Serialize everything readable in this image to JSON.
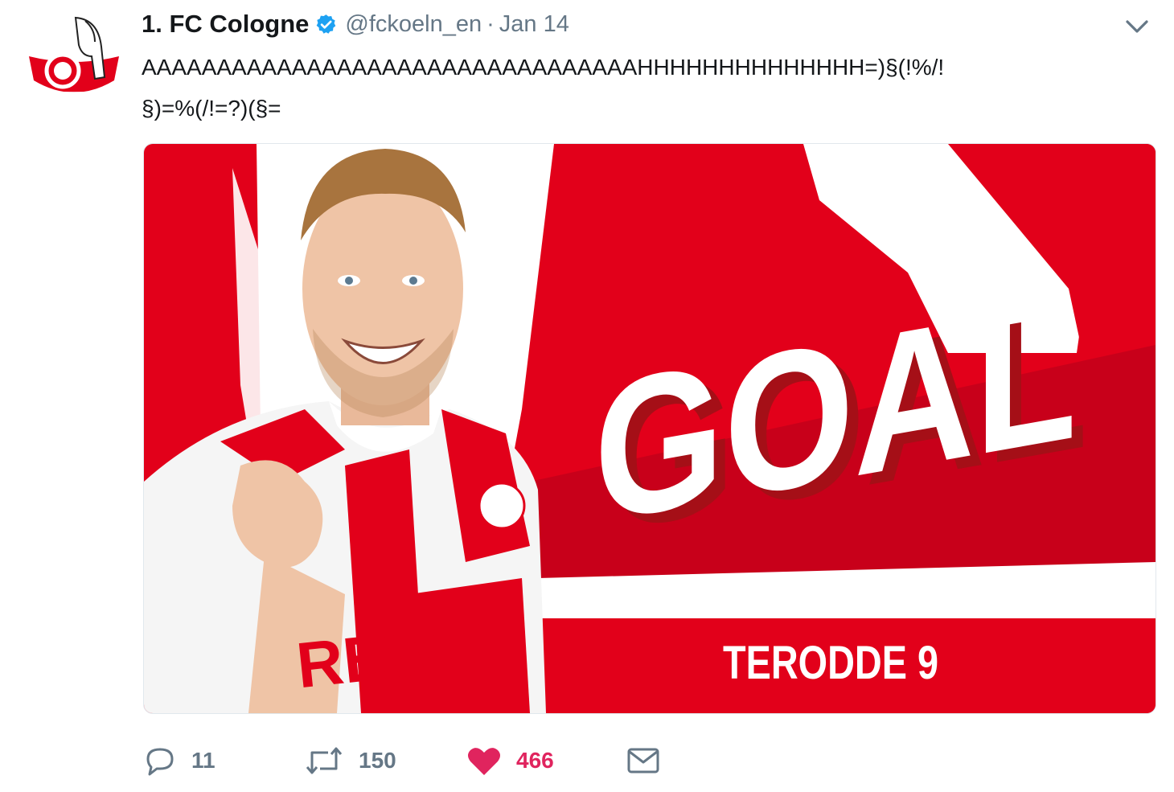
{
  "tweet": {
    "author_name": "1. FC Cologne",
    "handle": "@fckoeln_en",
    "separator": "·",
    "date": "Jan 14",
    "text_lines": [
      "AAAAAAAAAAAAAAAAAAAAAAAAAAAAAAAAAHHHHHHHHHHHHHH=)§(!%/!",
      "§)=%(/!=?)(§="
    ],
    "media": {
      "headline": "GOAL",
      "caption": "TERODDE 9",
      "shirt_sponsor": "REWE"
    },
    "actions": {
      "replies": "11",
      "retweets": "150",
      "likes": "466"
    }
  },
  "icons": {
    "verified": "verified-badge-icon",
    "caret": "chevron-down-icon",
    "reply": "reply-icon",
    "retweet": "retweet-icon",
    "like": "heart-icon",
    "dm": "envelope-icon"
  },
  "colors": {
    "brand_red": "#e2001a",
    "dark_red": "#a50f17",
    "verified_blue": "#1da1f2",
    "like_pink": "#e0245e",
    "muted_text": "#657786"
  }
}
